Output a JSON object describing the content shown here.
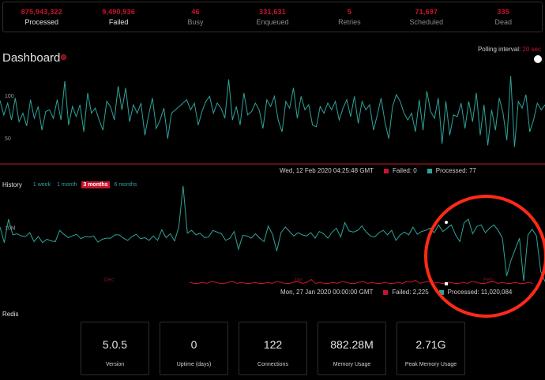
{
  "stats": [
    {
      "value": "875,943,322",
      "label": "Processed",
      "active": true
    },
    {
      "value": "9,490,936",
      "label": "Failed",
      "active": true
    },
    {
      "value": "46",
      "label": "Busy"
    },
    {
      "value": "331,631",
      "label": "Enqueued"
    },
    {
      "value": "5",
      "label": "Retries"
    },
    {
      "value": "71,697",
      "label": "Scheduled"
    },
    {
      "value": "335",
      "label": "Dead"
    }
  ],
  "dashboard": {
    "title": "Dashboard",
    "polling_label": "Polling interval:",
    "polling_value": "20 sec"
  },
  "realtime": {
    "legend": {
      "timestamp": "Wed, 12 Feb 2020 04:25:48 GMT",
      "failed": "Failed: 0",
      "processed": "Processed: 77"
    }
  },
  "history": {
    "title": "History",
    "ranges": [
      "1 week",
      "1 month",
      "3 months",
      "6 months"
    ],
    "active_range": "3 months",
    "legend": {
      "timestamp": "Mon, 27 Jan 2020 00:00:00 GMT",
      "failed": "Failed: 2,225",
      "processed": "Processed: 11,020,084"
    }
  },
  "redis": {
    "title": "Redis",
    "cards": [
      {
        "value": "5.0.5",
        "label": "Version"
      },
      {
        "value": "0",
        "label": "Uptime (days)"
      },
      {
        "value": "122",
        "label": "Connections"
      },
      {
        "value": "882.28M",
        "label": "Memory Usage"
      },
      {
        "value": "2.71G",
        "label": "Peak Memory Usage"
      }
    ]
  },
  "colors": {
    "failed": "#c8142c",
    "processed": "#2fa39a",
    "annotation": "#ff2a17"
  },
  "chart_data": [
    {
      "type": "line",
      "name": "realtime",
      "ylim": [
        20,
        130
      ],
      "y_ticks": [
        50,
        100
      ],
      "grid": false,
      "series": [
        {
          "name": "Processed",
          "values": [
            95,
            78,
            92,
            72,
            98,
            70,
            80,
            65,
            96,
            74,
            88,
            60,
            82,
            84,
            74,
            96,
            72,
            118,
            66,
            88,
            76,
            90,
            58,
            104,
            80,
            86,
            72,
            60,
            94,
            88,
            72,
            112,
            84,
            110,
            70,
            90,
            80,
            92,
            54,
            78,
            98,
            62,
            72,
            86,
            50,
            80,
            84,
            88,
            92,
            96,
            84,
            92,
            66,
            82,
            94,
            100,
            80,
            92,
            86,
            74,
            120,
            72,
            88,
            66,
            104,
            78,
            82,
            92,
            84,
            62,
            96,
            88,
            100,
            72,
            58,
            94,
            86,
            110,
            74,
            100,
            84,
            90,
            66,
            64,
            88,
            80,
            92,
            84,
            94,
            72,
            86,
            96,
            76,
            100,
            68,
            94,
            84,
            90,
            60,
            78,
            98,
            70,
            50,
            88,
            102,
            94,
            80,
            72,
            80,
            58,
            96,
            60,
            106,
            82,
            74,
            98,
            44,
            94,
            54,
            78,
            76,
            92,
            62,
            94,
            70,
            104,
            54,
            90,
            42,
            84,
            60,
            98,
            80,
            48,
            124,
            40,
            94,
            86,
            102,
            58,
            72,
            92,
            84,
            90
          ],
          "final_value": 77
        },
        {
          "name": "Failed",
          "values": [],
          "final_value": 0
        }
      ]
    },
    {
      "type": "line",
      "name": "history",
      "x_ticks": [
        "Dec",
        "Jan",
        "Feb"
      ],
      "y_ticks": [
        "10M"
      ],
      "ylim": [
        0,
        17000000
      ],
      "series": [
        {
          "name": "Processed",
          "values": [
            10.2,
            7.4,
            11.6,
            8.8,
            9.0,
            8.6,
            8.5,
            9.2,
            7.6,
            8.5,
            7.4,
            8.0,
            7.7,
            7.6,
            9.6,
            8.9,
            8.3,
            8.6,
            8.9,
            8.1,
            8.5,
            8.4,
            8.6,
            7.5,
            8.0,
            8.2,
            8.2,
            8.8,
            8.8,
            8.2,
            7.8,
            8.5,
            8.9,
            8.1,
            8.3,
            7.8,
            8.6,
            7.8,
            9.7,
            8.3,
            9.0,
            7.7,
            10.2,
            17.6,
            9.1,
            9.6,
            8.8,
            9.1,
            8.3,
            8.4,
            9.6,
            9.3,
            9.0,
            7.8,
            8.2,
            9.4,
            6.2,
            8.7,
            8.6,
            8.2,
            9.0,
            8.2,
            7.6,
            10.4,
            8.9,
            5.9,
            9.2,
            10.2,
            9.4,
            8.6,
            9.2,
            8.8,
            8.6,
            9.2,
            8.2,
            9.4,
            9.0,
            8.2,
            9.3,
            10.0,
            8.4,
            11.0,
            9.5,
            9.3,
            9.6,
            10.4,
            9.3,
            8.6,
            8.4,
            9.2,
            9.6,
            8.8,
            9.6,
            7.8,
            8.8,
            9.3,
            8.8,
            10.2,
            8.9,
            9.4,
            9.6,
            10.0,
            9.2,
            10.6,
            9.4,
            10.0,
            10.6,
            8.8,
            7.6,
            11.0,
            11.6,
            9.0,
            10.3,
            10.6,
            9.2,
            10.0,
            10.6,
            9.6,
            8.2,
            1.4,
            4.2,
            6.2,
            8.2,
            0.5,
            8.8,
            9.8,
            8.6,
            2.2,
            0.4
          ],
          "hovered": "11,020,084"
        },
        {
          "name": "Failed",
          "values": [],
          "hovered": "2,225"
        }
      ]
    }
  ]
}
